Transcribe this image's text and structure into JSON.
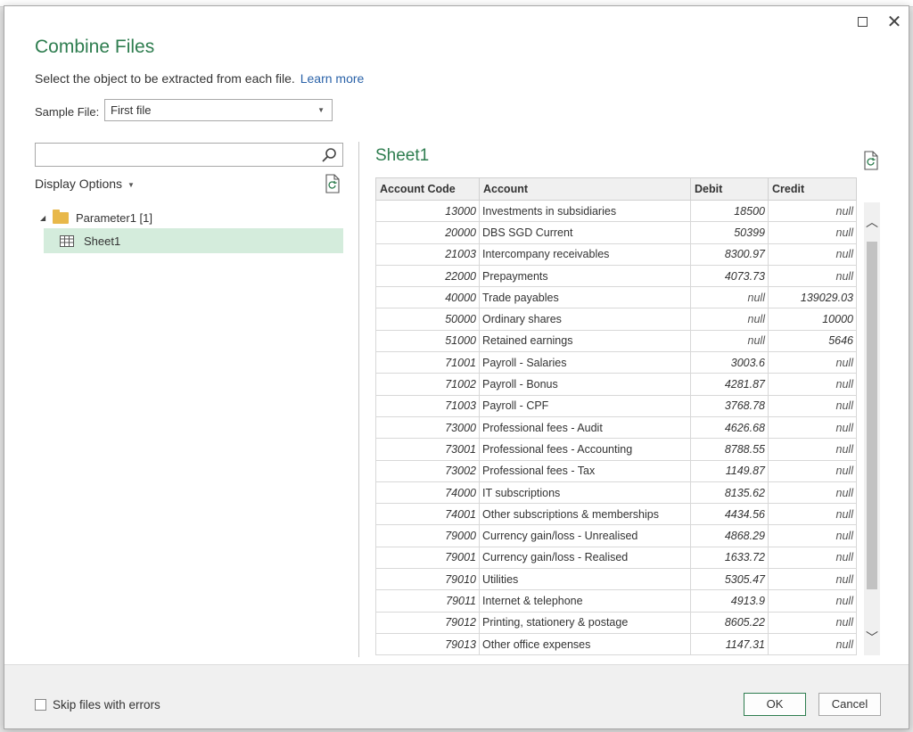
{
  "dialog": {
    "title": "Combine Files",
    "subtitle": "Select the object to be extracted from each file.",
    "learn_more": "Learn more"
  },
  "sample_file": {
    "label": "Sample File:",
    "value": "First file"
  },
  "search": {
    "placeholder": "",
    "value": ""
  },
  "display_options": "Display Options",
  "tree": {
    "parameter": "Parameter1 [1]",
    "sheet": "Sheet1"
  },
  "preview": {
    "title": "Sheet1",
    "columns": [
      "Account Code",
      "Account",
      "Debit",
      "Credit"
    ],
    "rows": [
      {
        "code": "13000",
        "account": "Investments in subsidiaries",
        "debit": "18500",
        "credit": "null"
      },
      {
        "code": "20000",
        "account": "DBS SGD Current",
        "debit": "50399",
        "credit": "null"
      },
      {
        "code": "21003",
        "account": "Intercompany receivables",
        "debit": "8300.97",
        "credit": "null"
      },
      {
        "code": "22000",
        "account": "Prepayments",
        "debit": "4073.73",
        "credit": "null"
      },
      {
        "code": "40000",
        "account": "Trade payables",
        "debit": "null",
        "credit": "139029.03"
      },
      {
        "code": "50000",
        "account": "Ordinary shares",
        "debit": "null",
        "credit": "10000"
      },
      {
        "code": "51000",
        "account": "Retained earnings",
        "debit": "null",
        "credit": "5646"
      },
      {
        "code": "71001",
        "account": "Payroll - Salaries",
        "debit": "3003.6",
        "credit": "null"
      },
      {
        "code": "71002",
        "account": "Payroll - Bonus",
        "debit": "4281.87",
        "credit": "null"
      },
      {
        "code": "71003",
        "account": "Payroll - CPF",
        "debit": "3768.78",
        "credit": "null"
      },
      {
        "code": "73000",
        "account": "Professional fees - Audit",
        "debit": "4626.68",
        "credit": "null"
      },
      {
        "code": "73001",
        "account": "Professional fees - Accounting",
        "debit": "8788.55",
        "credit": "null"
      },
      {
        "code": "73002",
        "account": "Professional fees - Tax",
        "debit": "1149.87",
        "credit": "null"
      },
      {
        "code": "74000",
        "account": "IT subscriptions",
        "debit": "8135.62",
        "credit": "null"
      },
      {
        "code": "74001",
        "account": "Other subscriptions & memberships",
        "debit": "4434.56",
        "credit": "null"
      },
      {
        "code": "79000",
        "account": "Currency gain/loss - Unrealised",
        "debit": "4868.29",
        "credit": "null"
      },
      {
        "code": "79001",
        "account": "Currency gain/loss - Realised",
        "debit": "1633.72",
        "credit": "null"
      },
      {
        "code": "79010",
        "account": "Utilities",
        "debit": "5305.47",
        "credit": "null"
      },
      {
        "code": "79011",
        "account": "Internet & telephone",
        "debit": "4913.9",
        "credit": "null"
      },
      {
        "code": "79012",
        "account": "Printing, stationery & postage",
        "debit": "8605.22",
        "credit": "null"
      },
      {
        "code": "79013",
        "account": "Other office expenses",
        "debit": "1147.31",
        "credit": "null"
      }
    ]
  },
  "footer": {
    "skip_label": "Skip files with errors",
    "ok": "OK",
    "cancel": "Cancel"
  },
  "colors": {
    "title_green": "#2e7d4f",
    "selected_row": "#d4ecdc",
    "link_blue": "#2a62a8"
  },
  "icons": [
    "maximize-icon",
    "close-icon",
    "search-icon",
    "refresh-icon",
    "folder-icon",
    "table-icon",
    "expand-icon",
    "chevron-up-icon",
    "chevron-down-icon"
  ]
}
